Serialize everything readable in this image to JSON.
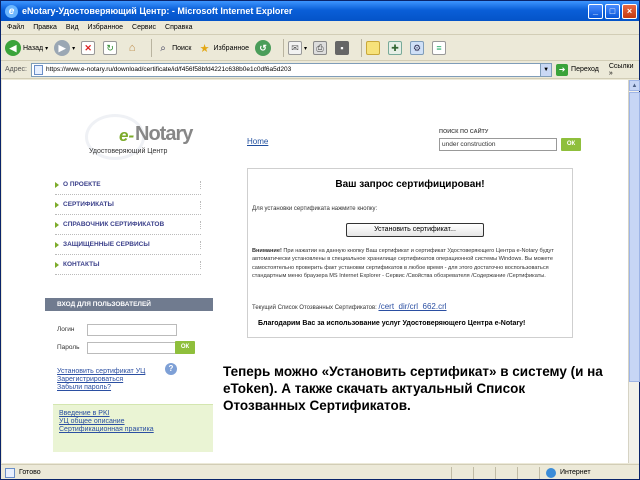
{
  "window": {
    "title": "eNotary-Удостоверяющий Центр: - Microsoft Internet Explorer",
    "controls": [
      "_",
      "□",
      "×"
    ]
  },
  "menu": [
    "Файл",
    "Правка",
    "Вид",
    "Избранное",
    "Сервис",
    "Справка"
  ],
  "toolbar": {
    "back": "Назад",
    "search": "Поиск",
    "favorites": "Избранное"
  },
  "address": {
    "label": "Адрес:",
    "url": "https://www.e-notary.ru/download/certificate/id/f456f58bfd4221c638b0e1c0df6a5d203",
    "go": "Переход",
    "links": "Ссылки »"
  },
  "site": {
    "logo_e": "e-",
    "logo_brand": "Notary",
    "logo_sub": "Удостоверяющий Центр",
    "home_link": "Home",
    "search_label": "ПОИСК ПО САЙТУ",
    "search_value": "under construction",
    "ok": "ОК",
    "nav": [
      "О ПРОЕКТЕ",
      "СЕРТИФИКАТЫ",
      "СПРАВОЧНИК СЕРТИФИКАТОВ",
      "ЗАЩИЩЕННЫЕ СЕРВИСЫ",
      "КОНТАКТЫ"
    ],
    "login": {
      "header": "ВХОД ДЛЯ ПОЛЬЗОВАТЕЛЕЙ",
      "login_label": "Логин",
      "password_label": "Пароль",
      "links": [
        "Установить сертификат УЦ",
        "Зарегистрироваться",
        "Забыли пароль?"
      ]
    },
    "extra_links": [
      "Введение в PKI",
      "УЦ общее описание",
      "Сертификационная практика"
    ]
  },
  "cert": {
    "title": "Ваш запрос сертифицирован!",
    "prompt": "Для установки сертификата нажмите кнопку:",
    "button": "Установить сертификат...",
    "note_bold": "Внимание!",
    "note": "При нажатии на данную кнопку Ваш сертификат и сертификат Удостоверяющего Центра e-Notary будут автоматически установлены в специальное хранилище сертификатов операционной системы Windows. Вы можете самостоятельно проверить факт установки сертификатов в любое время - для этого достаточно воспользоваться стандартным меню браузера MS Internet Explorer - Сервис /Свойства обозревателя /Содержание /Сертификаты.",
    "crl_label": "Текущий Список Отозванных Сертификатов:",
    "crl_link": "/cert_dir/crl_662.crl",
    "thanks": "Благодарим Вас за использование услуг Удостоверяющего Центра e-Notary!"
  },
  "caption": "Теперь можно «Установить сертификат» в систему (и на eToken). А также скачать актуальный Список Отозванных Сертификатов.",
  "status": {
    "text": "Готово",
    "zone": "Интернет"
  }
}
